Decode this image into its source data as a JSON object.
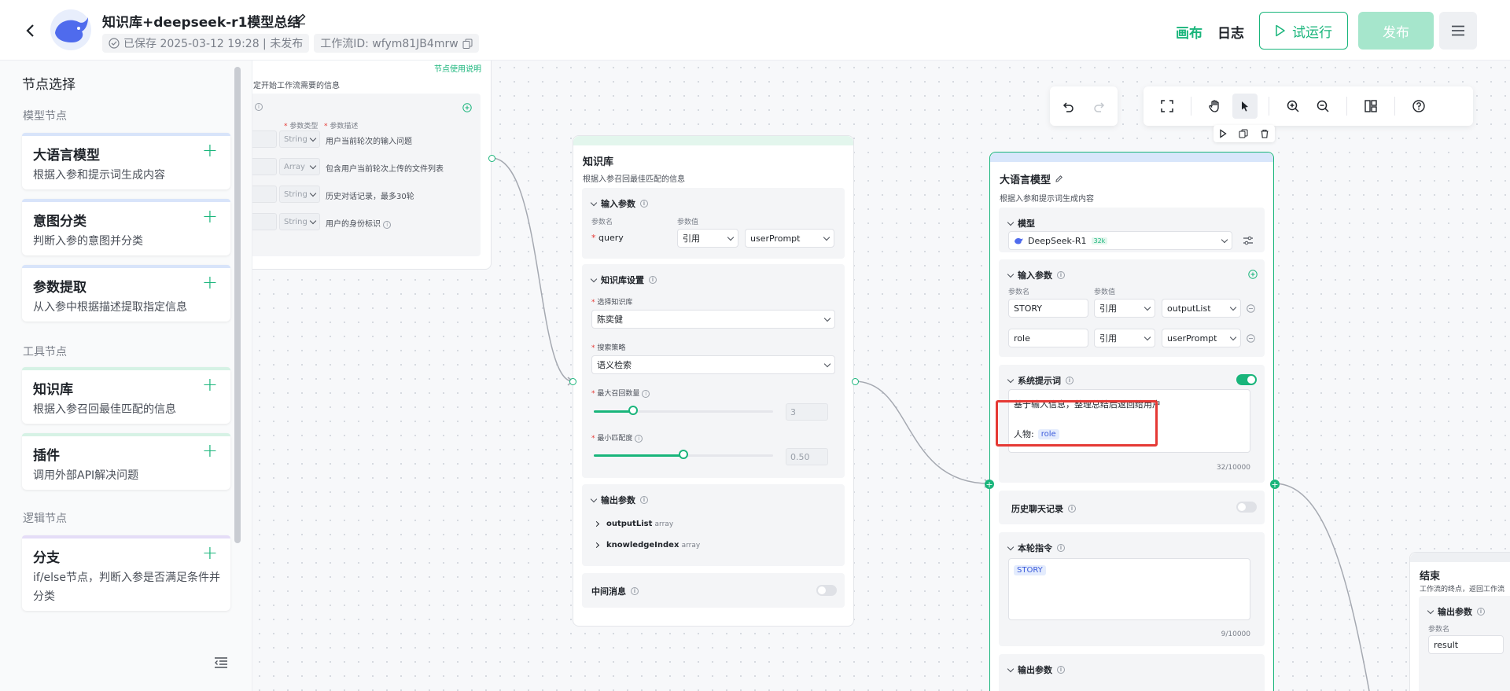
{
  "header": {
    "title": "知识库+deepseek-r1模型总结",
    "saved": "已保存 2025-03-12 19:28 | 未发布",
    "workflow_id": "工作流ID: wfym81JB4mrw",
    "tab_canvas": "画布",
    "tab_log": "日志",
    "try_run": "试运行",
    "publish": "发布",
    "accent": "#19b57b"
  },
  "sidebar": {
    "title": "节点选择",
    "sections": {
      "model": "模型节点",
      "tool": "工具节点",
      "logic": "逻辑节点"
    },
    "cards": [
      {
        "name": "大语言模型",
        "desc": "根据入参和提示词生成内容"
      },
      {
        "name": "意图分类",
        "desc": "判断入参的意图并分类"
      },
      {
        "name": "参数提取",
        "desc": "从入参中根据描述提取指定信息"
      },
      {
        "name": "知识库",
        "desc": "根据入参召回最佳匹配的信息"
      },
      {
        "name": "插件",
        "desc": "调用外部API解决问题"
      },
      {
        "name": "分支",
        "desc": "if/else节点，判断入参是否满足条件并分类"
      }
    ]
  },
  "start_node": {
    "link": "节点使用说明",
    "desc": "定开始工作流需要的信息",
    "col_type": "参数类型",
    "col_desc": "参数描述",
    "rows": [
      {
        "type": "String",
        "desc": "用户当前轮次的输入问题"
      },
      {
        "type": "Array",
        "desc": "包含用户当前轮次上传的文件列表"
      },
      {
        "type": "String",
        "desc": "历史对话记录，最多30轮"
      },
      {
        "type": "String",
        "desc": "用户的身份标识"
      }
    ]
  },
  "kb_node": {
    "title": "知识库",
    "desc": "根据入参召回最佳匹配的信息",
    "input_title": "输入参数",
    "col_name": "参数名",
    "col_value": "参数值",
    "param_name": "query",
    "ref": "引用",
    "ref_value": "userPrompt",
    "settings_title": "知识库设置",
    "select_kb_label": "选择知识库",
    "select_kb_value": "陈奕健",
    "strategy_label": "搜索策略",
    "strategy_value": "语义检索",
    "max_label": "最大召回数量",
    "max_value": "3",
    "max_fraction": 0.22,
    "min_label": "最小匹配度",
    "min_value": "0.50",
    "min_fraction": 0.5,
    "output_title": "输出参数",
    "outputs": [
      {
        "name": "outputList",
        "type": "array"
      },
      {
        "name": "knowledgeIndex",
        "type": "array"
      }
    ],
    "middle_msg": "中间消息"
  },
  "llm_node": {
    "title": "大语言模型",
    "desc": "根据入参和提示词生成内容",
    "model_title": "模型",
    "model_name": "DeepSeek-R1",
    "model_ctx": "32k",
    "input_title": "输入参数",
    "col_name": "参数名",
    "col_value": "参数值",
    "inputs": [
      {
        "name": "STORY",
        "ref": "引用",
        "value": "outputList"
      },
      {
        "name": "role",
        "ref": "引用",
        "value": "userPrompt"
      }
    ],
    "system_prompt_title": "系统提示词",
    "system_prompt_text": "基于输入信息，整理总结后返回给用户",
    "role_line_prefix": "人物:",
    "role_tag": "role",
    "system_prompt_count": "32/10000",
    "history_title": "历史聊天记录",
    "instruction_title": "本轮指令",
    "instruction_tag": "STORY",
    "instruction_count": "9/10000",
    "output_title": "输出参数"
  },
  "end_node": {
    "title": "结束",
    "desc": "工作流的终点，返回工作流",
    "output_title": "输出参数",
    "col_name": "参数名",
    "param_name": "result"
  }
}
